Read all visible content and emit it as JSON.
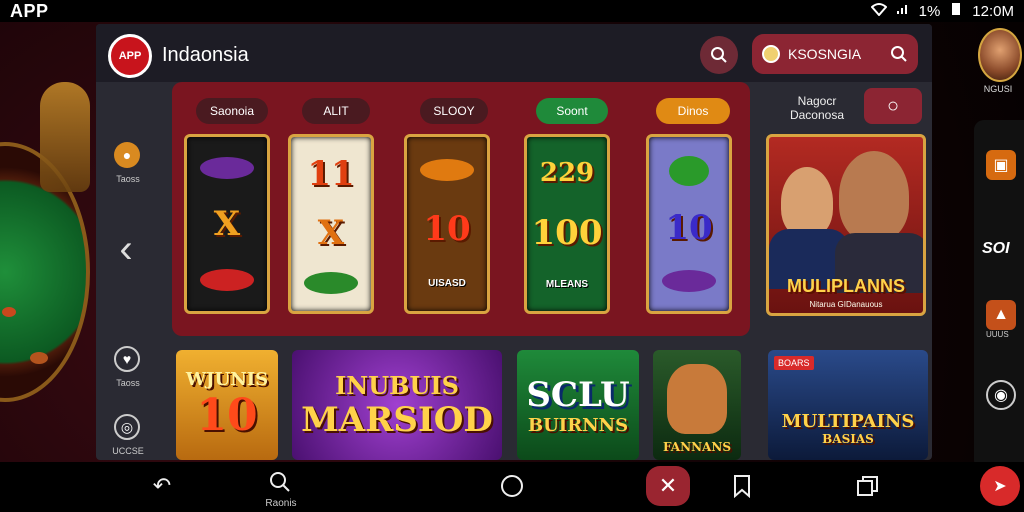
{
  "statusbar": {
    "app_label": "APP",
    "time": "12:0M",
    "battery": "1%"
  },
  "header": {
    "brand": "Indaonsia",
    "logo_text": "APP",
    "search_text": "KSOSNGIA"
  },
  "right_rail": {
    "avatar_label": "NGUSI",
    "item2": "SOI",
    "item3": "UUUS"
  },
  "left_nav": {
    "item1": "Taoss",
    "item2": "Taoss",
    "item3": "UCCSE"
  },
  "filters": [
    "Saonoia",
    "ALIT",
    "SLOOY",
    "Soont",
    "Dinos"
  ],
  "featured": {
    "label": "Nagocr Daconosa",
    "title": "MULIPLANNS",
    "subtitle": "Nitarua GIDanauous"
  },
  "reels": [
    {
      "symbol": "X"
    },
    {
      "symbol_top": "11",
      "symbol_mid": "X"
    },
    {
      "symbol": "10",
      "caption": "UISASD"
    },
    {
      "symbol_top": "229",
      "symbol": "100",
      "caption": "MLEANS"
    },
    {
      "symbol": "10"
    }
  ],
  "tiles": [
    {
      "title": "WJUNIS",
      "number": "10"
    },
    {
      "title": "INUBUIS",
      "subtitle": "MARSIOD"
    },
    {
      "title": "SCLU",
      "subtitle": "BUIRNNS"
    },
    {
      "caption": "FANNANS"
    },
    {
      "label": "BOARS",
      "title": "MULTIPAINS",
      "subtitle": "BASIAS"
    }
  ],
  "navbar": {
    "search_label": "Raonis"
  },
  "colors": {
    "accent": "#8c2533",
    "gold": "#d9a441",
    "panel": "#7a1520"
  }
}
